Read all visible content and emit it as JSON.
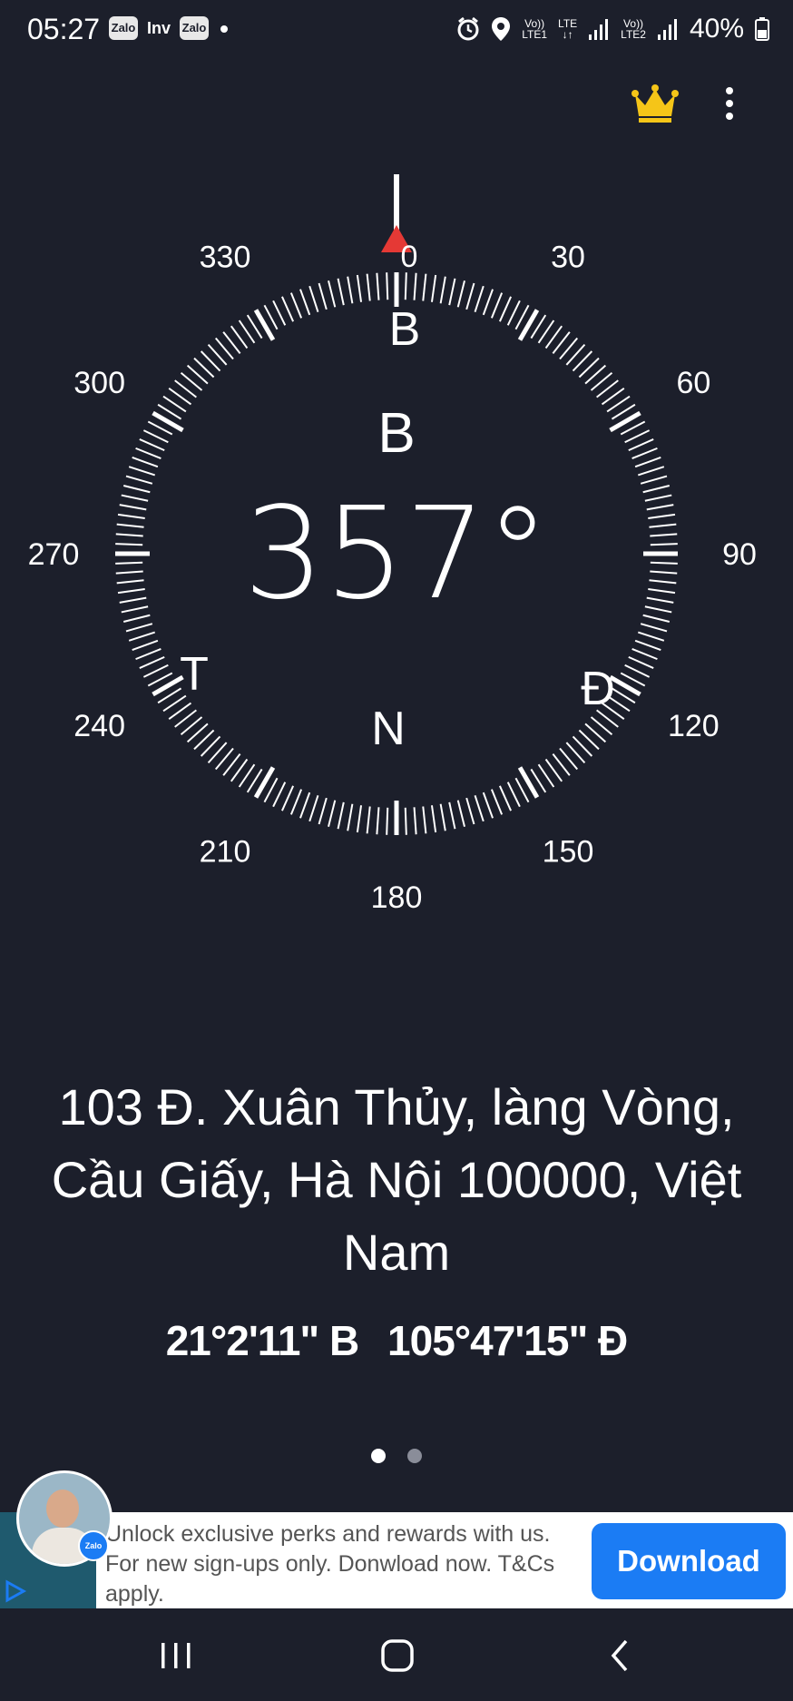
{
  "status_bar": {
    "time": "05:27",
    "badges": [
      "Zalo",
      "Inv",
      "Zalo"
    ],
    "net1_top": "Vo))",
    "net1_bottom": "LTE1",
    "lte_label": "LTE",
    "net2_top": "Vo))",
    "net2_bottom": "LTE2",
    "battery": "40%"
  },
  "toolbar": {
    "premium_icon": "crown-icon",
    "menu_icon": "more-vert-icon",
    "crown_color": "#f5c518"
  },
  "compass": {
    "heading": "357°",
    "heading_dir": "B",
    "north_indicator_color": "#e53935",
    "cardinals": {
      "north": "B",
      "east": "Đ",
      "south": "N",
      "west": "T"
    },
    "degree_labels": [
      "0",
      "30",
      "60",
      "90",
      "120",
      "150",
      "180",
      "210",
      "240",
      "270",
      "300",
      "330"
    ]
  },
  "location": {
    "address": "103 Đ. Xuân Thủy, làng Vòng, Cầu Giấy, Hà Nội 100000, Việt Nam",
    "latitude": "21°2'11\" B",
    "longitude": "105°47'15\" Đ"
  },
  "pager": {
    "active_page": 1,
    "page_count": 2
  },
  "ad": {
    "text": "Unlock exclusive perks and rewards with us. For new sign-ups only. Donwload now. T&Cs apply.",
    "button": "Download",
    "brand_badge": "Zalo"
  },
  "navbar": {
    "recents_icon": "recents-icon",
    "home_icon": "home-icon",
    "back_icon": "back-icon"
  }
}
